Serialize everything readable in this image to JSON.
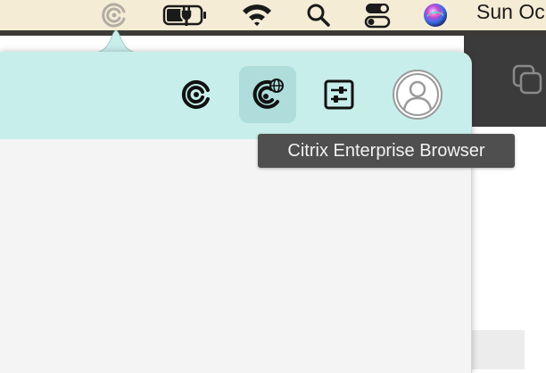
{
  "menubar": {
    "icons": [
      "citrix-workspace-icon",
      "battery-charging-icon",
      "wifi-icon",
      "search-icon",
      "control-center-icon",
      "siri-icon"
    ],
    "clock": "Sun Oc"
  },
  "toolbar": {
    "buttons": [
      {
        "icon": "citrix-workspace-icon",
        "active": false
      },
      {
        "icon": "citrix-enterprise-browser-icon",
        "active": true
      },
      {
        "icon": "preferences-icon",
        "active": false
      },
      {
        "icon": "account-avatar-icon",
        "active": false
      }
    ]
  },
  "tooltip": {
    "text": "Citrix Enterprise Browser"
  },
  "colors": {
    "menubar": "#f5ecd6",
    "header": "#c8eeec",
    "active_button": "#aedddb",
    "tooltip_bg": "#4f4f4f",
    "body": "#f4f4f4"
  }
}
